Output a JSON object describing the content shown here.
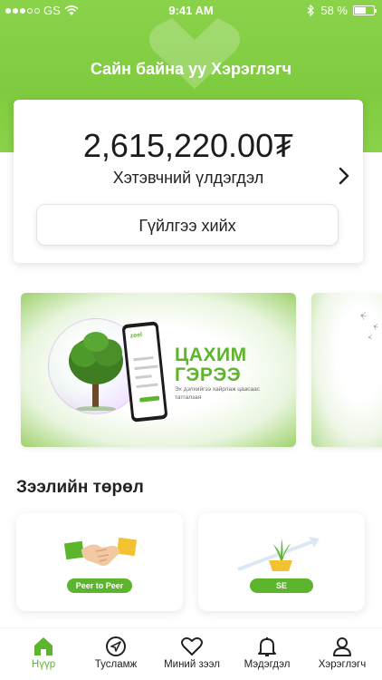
{
  "status_bar": {
    "carrier": "GS",
    "time": "9:41 AM",
    "battery_percent_text": "58 %",
    "battery_level": 0.58,
    "signal_bars_filled": 3,
    "signal_bars_total": 5
  },
  "header": {
    "greeting": "Сайн байна уу Хэрэглэгч",
    "accent_color": "#7fcb3f"
  },
  "balance": {
    "amount": "2,615,220.00₮",
    "label": "Хэтэвчний үлдэгдэл",
    "transact_label": "Гүйлгээ хийх"
  },
  "banners": [
    {
      "title_line1": "ЦАХИМ",
      "title_line2": "ГЭРЭЭ",
      "subtitle": "Эх дэлхийгээ хайрлаж цаасаас татгалзая",
      "phone_logo": "zeel"
    }
  ],
  "loan_types": {
    "title": "Зээлийн төрөл",
    "items": [
      {
        "label": "Peer to Peer",
        "icon": "handshake-icon"
      },
      {
        "label": "SE",
        "icon": "growth-plant-icon"
      }
    ]
  },
  "tab_bar": {
    "items": [
      {
        "label": "Нүүр",
        "icon": "home-icon",
        "active": true
      },
      {
        "label": "Тусламж",
        "icon": "navigation-icon",
        "active": false
      },
      {
        "label": "Миний зээл",
        "icon": "heart-icon",
        "active": false
      },
      {
        "label": "Мэдэгдэл",
        "icon": "bell-icon",
        "active": false
      },
      {
        "label": "Хэрэглэгч",
        "icon": "user-icon",
        "active": false
      }
    ]
  },
  "colors": {
    "brand_green": "#5db52d",
    "header_green": "#7fcb3f"
  }
}
